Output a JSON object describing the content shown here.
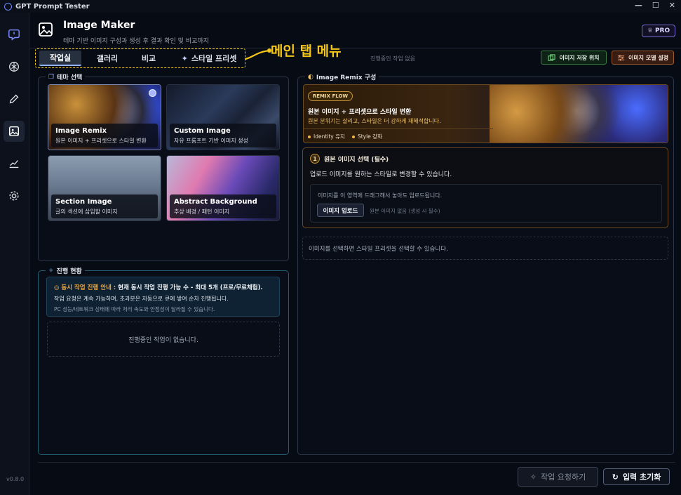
{
  "window": {
    "title": "GPT Prompt Tester",
    "controls": [
      "—",
      "☐",
      "✕"
    ]
  },
  "sidebar": {
    "version": "v0.8.0"
  },
  "header": {
    "title": "Image Maker",
    "subtitle": "테마 기반 이미지 구성과 생성 후 결과 확인 및 비교까지",
    "badge": "PRO"
  },
  "tabs": [
    {
      "label": "작업실",
      "active": true
    },
    {
      "label": "갤러리"
    },
    {
      "label": "비교"
    },
    {
      "label": "스타일 프리셋"
    }
  ],
  "annotation": {
    "label": "메인 탭 메뉴",
    "color": "#f5c518"
  },
  "status": {
    "no_task": "진행중인 작업 없음"
  },
  "actions": {
    "save_location": "이미지 저장 위치",
    "model_settings": "이미지 모델 설정"
  },
  "theme_panel": {
    "title": "테마 선택",
    "cards": [
      {
        "title": "Image Remix",
        "desc": "원본 이미지 + 프리셋으로 스타일 변환",
        "selected": true
      },
      {
        "title": "Custom Image",
        "desc": "자유 프롬프트 기반 이미지 생성"
      },
      {
        "title": "Section Image",
        "desc": "글의 섹션에 삽입할 이미지"
      },
      {
        "title": "Abstract Background",
        "desc": "추상 배경 / 패턴 이미지"
      }
    ]
  },
  "progress_panel": {
    "title": "진행 현황",
    "notice_label": "동시 작업 진행 안내 :",
    "notice_text": "현재 동시 작업 진행 가능 수 - 최대 5개 (프로/무료체험).",
    "notice_line2": "작업 요청은 계속 가능하며, 초과분은 자동으로 큐에 쌓여 순차 진행됩니다.",
    "notice_line3": "PC 성능/네트워크 상태에 따라 처리 속도와 안정성이 달라질 수 있습니다.",
    "empty": "진행중인 작업이 없습니다."
  },
  "remix_panel": {
    "title": "Image Remix 구성",
    "badge": "REMIX FLOW",
    "heading": "원본 이미지 + 프리셋으로 스타일 변환",
    "desc": "원본 분위기는 살리고, 스타일은 더 강하게 재해석합니다.",
    "tags": [
      "Identity 유지",
      "Style 강화"
    ],
    "step": {
      "num": "1",
      "title": "원본 이미지 선택 (필수)",
      "desc": "업로드 이미지를 원하는 스타일로 변경할 수 있습니다.",
      "drop_text": "이미지를 이 영역에 드래그해서 놓아도 업로드됩니다.",
      "upload_label": "이미지 업로드",
      "upload_hint": "원본 이미지 없음 (생성 시 필수)"
    },
    "preset_hint": "이미지를 선택하면 스타일 프리셋을 선택할 수 있습니다."
  },
  "footer": {
    "submit": "작업 요청하기",
    "reset": "입력 초기화"
  }
}
